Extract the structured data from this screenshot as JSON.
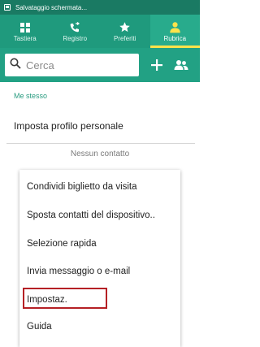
{
  "status_bar": {
    "text": "Salvataggio schermata..."
  },
  "tabs": [
    {
      "label": "Tastiera",
      "icon": "keypad-icon",
      "active": false
    },
    {
      "label": "Registro",
      "icon": "call-log-icon",
      "active": false
    },
    {
      "label": "Preferiti",
      "icon": "star-icon",
      "active": false
    },
    {
      "label": "Rubrica",
      "icon": "person-icon",
      "active": true
    }
  ],
  "search": {
    "placeholder": "Cerca",
    "value": ""
  },
  "actions": {
    "add_icon": "plus-icon",
    "groups_icon": "groups-icon"
  },
  "section": {
    "title": "Me stesso"
  },
  "profile": {
    "label": "Imposta profilo personale"
  },
  "empty": {
    "label": "Nessun contatto"
  },
  "menu": {
    "items": [
      "Condividi biglietto da visita",
      "Sposta contatti del dispositivo..",
      "Selezione rapida",
      "Invia messaggio o e-mail",
      "Impostaz.",
      "Guida"
    ],
    "highlighted_index": 4
  },
  "colors": {
    "status_bar": "#1a7a63",
    "tab_bar": "#1f9a7d",
    "accent": "#2a9c80",
    "active_tab_indicator": "#ffe34a",
    "highlight_box": "#b52025"
  }
}
